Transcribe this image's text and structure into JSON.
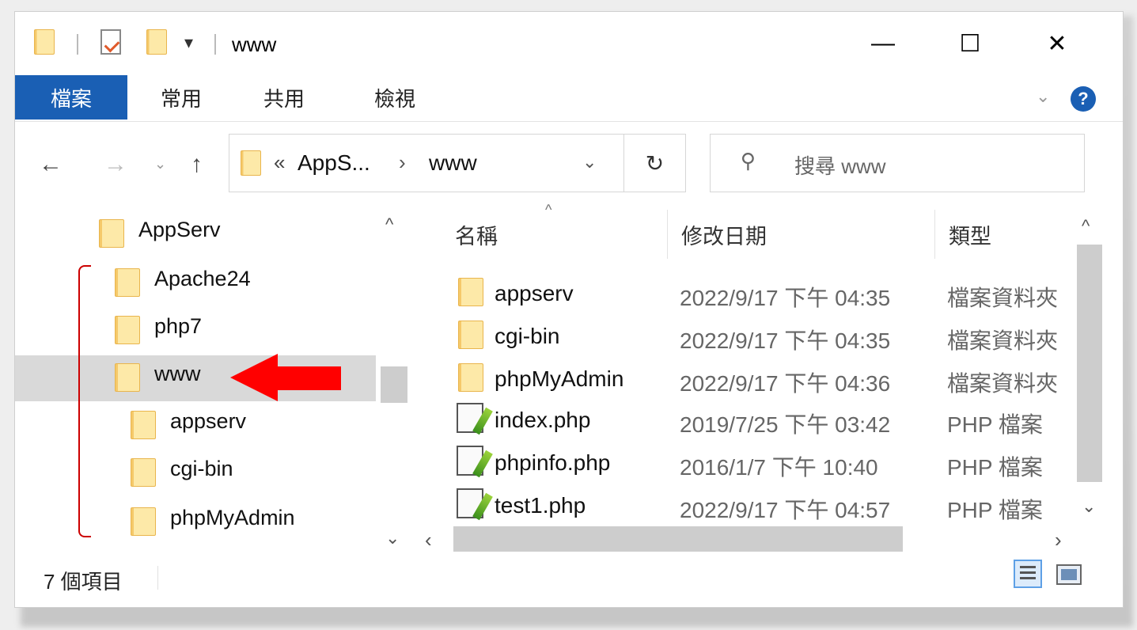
{
  "window": {
    "title": "www",
    "controls": {
      "minimize": "—",
      "maximize": "☐",
      "close": "✕"
    }
  },
  "ribbon": {
    "tabs": [
      "檔案",
      "常用",
      "共用",
      "檢視"
    ],
    "help": "?"
  },
  "address": {
    "prefix": "«",
    "crumb1": "AppS...",
    "sep": "›",
    "crumb2": "www",
    "search_placeholder": "搜尋 www"
  },
  "nav_tree": [
    {
      "label": "AppServ",
      "level": 0
    },
    {
      "label": "Apache24",
      "level": 1
    },
    {
      "label": "php7",
      "level": 1
    },
    {
      "label": "www",
      "level": 1,
      "selected": true
    },
    {
      "label": "appserv",
      "level": 2
    },
    {
      "label": "cgi-bin",
      "level": 2
    },
    {
      "label": "phpMyAdmin",
      "level": 2
    }
  ],
  "columns": {
    "name": "名稱",
    "date": "修改日期",
    "type": "類型"
  },
  "files": [
    {
      "name": "appserv",
      "date": "2022/9/17 下午 04:35",
      "type": "檔案資料夾",
      "icon": "folder-icon"
    },
    {
      "name": "cgi-bin",
      "date": "2022/9/17 下午 04:35",
      "type": "檔案資料夾",
      "icon": "folder-icon"
    },
    {
      "name": "phpMyAdmin",
      "date": "2022/9/17 下午 04:36",
      "type": "檔案資料夾",
      "icon": "folder-icon"
    },
    {
      "name": "index.php",
      "date": "2019/7/25 下午 03:42",
      "type": "PHP 檔案",
      "icon": "php-file-icon"
    },
    {
      "name": "phpinfo.php",
      "date": "2016/1/7 下午 10:40",
      "type": "PHP 檔案",
      "icon": "php-file-icon"
    },
    {
      "name": "test1.php",
      "date": "2022/9/17 下午 04:57",
      "type": "PHP 檔案",
      "icon": "php-file-icon"
    }
  ],
  "status": {
    "item_count": "7 個項目"
  },
  "colors": {
    "accent": "#1a5fb4",
    "annotation_arrow": "#ff0000",
    "annotation_bracket": "#cc0000",
    "selection": "#d9d9d9"
  }
}
